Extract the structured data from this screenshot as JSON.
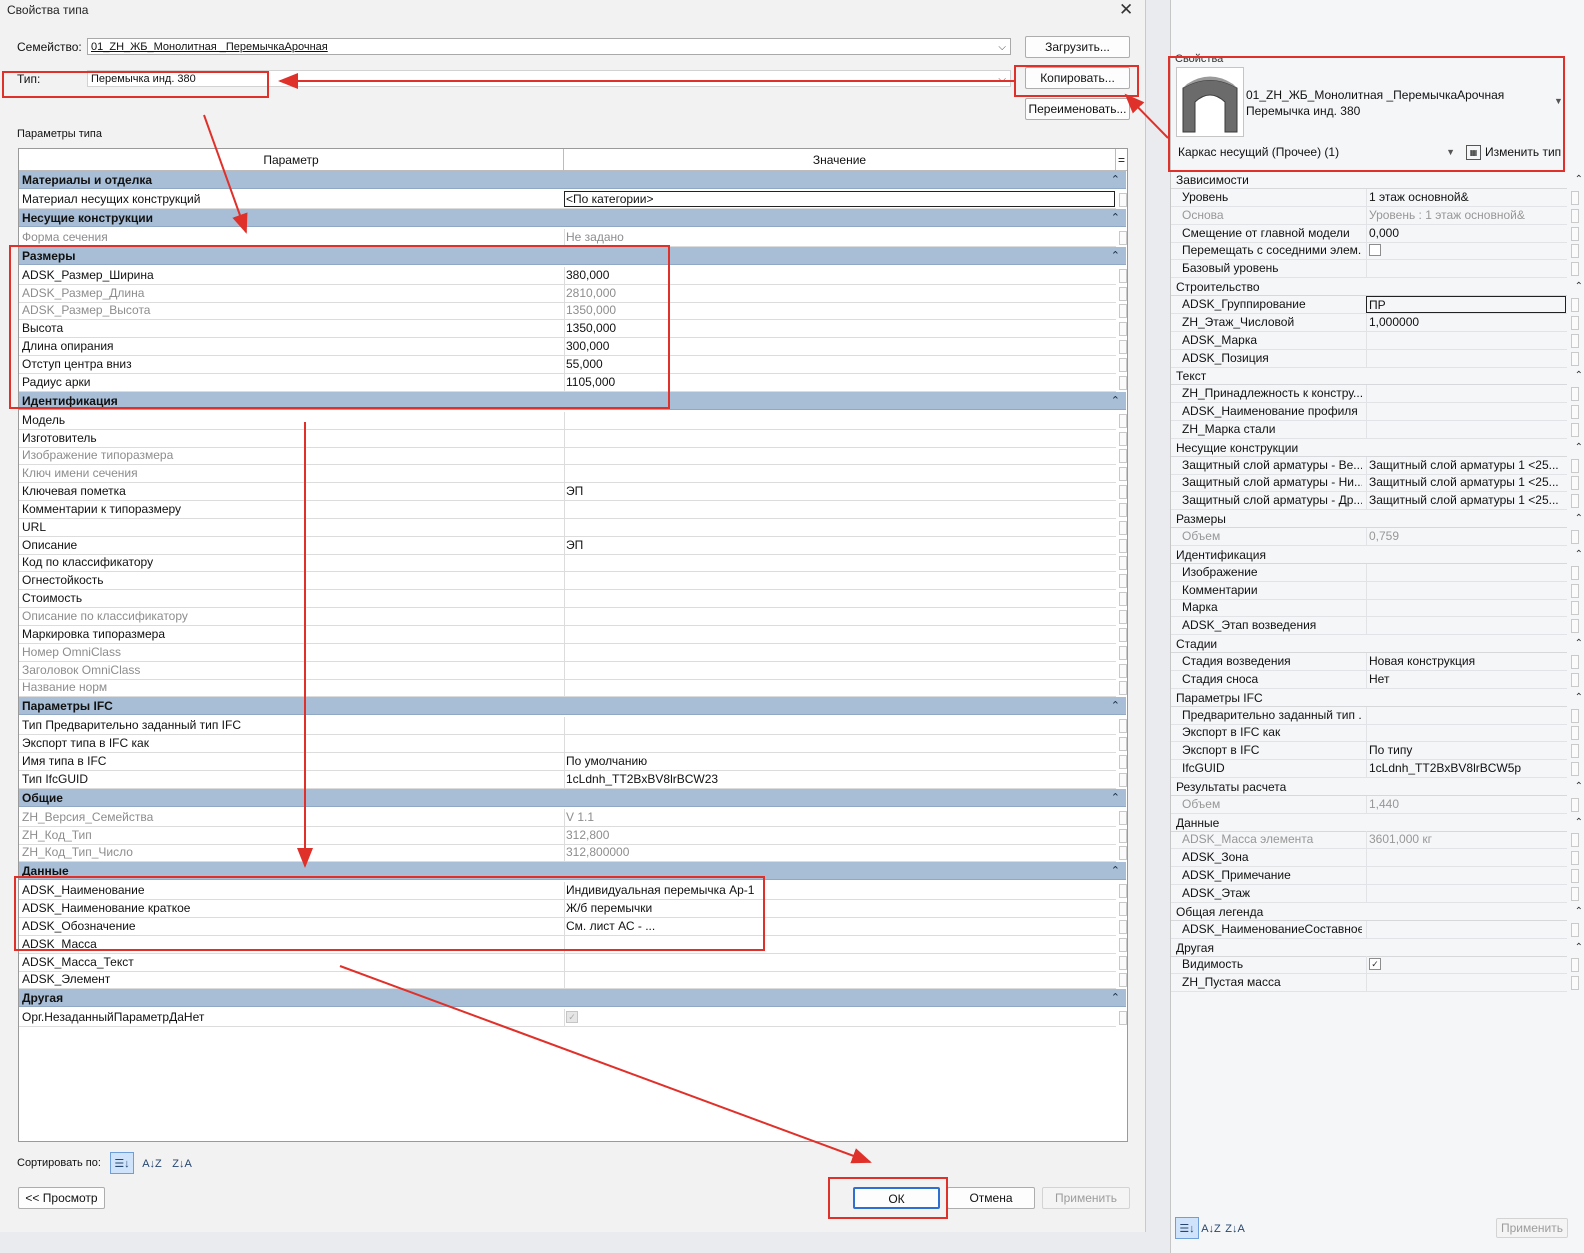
{
  "dialog": {
    "title": "Свойства типа",
    "close": "✕",
    "family_label": "Семейство:",
    "family_value": "01_ZH_ЖБ_Монолитная _ПеремычкаАрочная",
    "type_label": "Тип:",
    "type_value": "Перемычка инд. 380",
    "load_button": "Загрузить...",
    "copy_button": "Копировать...",
    "rename_button": "Переименовать...",
    "type_params_label": "Параметры типа",
    "col_param": "Параметр",
    "col_value": "Значение",
    "col_eq": "=",
    "sort_label": "Сортировать по:",
    "preview_button": "<< Просмотр",
    "ok_button": "ОК",
    "cancel_button": "Отмена",
    "apply_button": "Применить"
  },
  "grid_rows": [
    {
      "kind": "group",
      "name": "Материалы и отделка"
    },
    {
      "kind": "row",
      "name": "Материал несущих конструкций",
      "value": "<По категории>",
      "boxed": true
    },
    {
      "kind": "group",
      "name": "Несущие конструкции"
    },
    {
      "kind": "row",
      "name": "Форма сечения",
      "value": "Не задано",
      "disabled": true
    },
    {
      "kind": "group",
      "name": "Размеры"
    },
    {
      "kind": "row",
      "name": "ADSK_Размер_Ширина",
      "value": "380,000"
    },
    {
      "kind": "row",
      "name": "ADSK_Размер_Длина",
      "value": "2810,000",
      "disabled": true
    },
    {
      "kind": "row",
      "name": "ADSK_Размер_Высота",
      "value": "1350,000",
      "disabled": true
    },
    {
      "kind": "row",
      "name": "Высота",
      "value": "1350,000"
    },
    {
      "kind": "row",
      "name": "Длина опирания",
      "value": "300,000"
    },
    {
      "kind": "row",
      "name": "Отступ центра вниз",
      "value": "55,000"
    },
    {
      "kind": "row",
      "name": "Радиус арки",
      "value": "1105,000"
    },
    {
      "kind": "group",
      "name": "Идентификация"
    },
    {
      "kind": "row",
      "name": "Модель",
      "value": ""
    },
    {
      "kind": "row",
      "name": "Изготовитель",
      "value": ""
    },
    {
      "kind": "row",
      "name": "Изображение типоразмера",
      "value": "",
      "disabled": true
    },
    {
      "kind": "row",
      "name": "Ключ имени сечения",
      "value": "",
      "disabled": true
    },
    {
      "kind": "row",
      "name": "Ключевая пометка",
      "value": "ЭП"
    },
    {
      "kind": "row",
      "name": "Комментарии к типоразмеру",
      "value": ""
    },
    {
      "kind": "row",
      "name": "URL",
      "value": ""
    },
    {
      "kind": "row",
      "name": "Описание",
      "value": "ЭП"
    },
    {
      "kind": "row",
      "name": "Код по классификатору",
      "value": ""
    },
    {
      "kind": "row",
      "name": "Огнестойкость",
      "value": ""
    },
    {
      "kind": "row",
      "name": "Стоимость",
      "value": ""
    },
    {
      "kind": "row",
      "name": "Описание по классификатору",
      "value": "",
      "disabled": true
    },
    {
      "kind": "row",
      "name": "Маркировка типоразмера",
      "value": ""
    },
    {
      "kind": "row",
      "name": "Номер OmniClass",
      "value": "",
      "disabled": true
    },
    {
      "kind": "row",
      "name": "Заголовок OmniClass",
      "value": "",
      "disabled": true
    },
    {
      "kind": "row",
      "name": "Название норм",
      "value": "",
      "disabled": true
    },
    {
      "kind": "group",
      "name": "Параметры IFC"
    },
    {
      "kind": "row",
      "name": "Тип Предварительно заданный тип IFC",
      "value": ""
    },
    {
      "kind": "row",
      "name": "Экспорт типа в IFC как",
      "value": ""
    },
    {
      "kind": "row",
      "name": "Имя типа в IFC",
      "value": "По умолчанию"
    },
    {
      "kind": "row",
      "name": "Тип IfcGUID",
      "value": "1cLdnh_TT2BxBV8lrBCW23"
    },
    {
      "kind": "group",
      "name": "Общие"
    },
    {
      "kind": "row",
      "name": "ZH_Версия_Семейства",
      "value": "V 1.1",
      "disabled": true
    },
    {
      "kind": "row",
      "name": "ZH_Код_Тип",
      "value": "312,800",
      "disabled": true
    },
    {
      "kind": "row",
      "name": "ZH_Код_Тип_Число",
      "value": "312,800000",
      "disabled": true
    },
    {
      "kind": "group",
      "name": "Данные"
    },
    {
      "kind": "row",
      "name": "ADSK_Наименование",
      "value": "Индивидуальная перемычка Ар-1"
    },
    {
      "kind": "row",
      "name": "ADSK_Наименование краткое",
      "value": "Ж/б перемычки"
    },
    {
      "kind": "row",
      "name": "ADSK_Обозначение",
      "value": "См. лист АС - ..."
    },
    {
      "kind": "row",
      "name": "ADSK_Масса",
      "value": ""
    },
    {
      "kind": "row",
      "name": "ADSK_Масса_Текст",
      "value": ""
    },
    {
      "kind": "row",
      "name": "ADSK_Элемент",
      "value": ""
    },
    {
      "kind": "group",
      "name": "Другая"
    },
    {
      "kind": "row",
      "name": "Орг.НезаданныйПараметрДаНет",
      "value": "",
      "checkbox": "disabled"
    }
  ],
  "properties": {
    "header": "Свойства",
    "family_name": "01_ZH_ЖБ_Монолитная _ПеремычкаАрочная",
    "type_name": "Перемычка инд. 380",
    "filter_value": "Каркас несущий (Прочее) (1)",
    "edit_type_button": "Изменить тип",
    "apply_button": "Применить",
    "rows": [
      {
        "kind": "group",
        "name": "Зависимости"
      },
      {
        "kind": "row",
        "name": "Уровень",
        "value": "1 этаж основной&"
      },
      {
        "kind": "row",
        "name": "Основа",
        "value": "Уровень : 1 этаж основной&",
        "disabled": true
      },
      {
        "kind": "row",
        "name": "Смещение от главной модели",
        "value": "0,000"
      },
      {
        "kind": "row",
        "name": "Перемещать с соседними элем...",
        "value": "",
        "checkbox": "empty"
      },
      {
        "kind": "row",
        "name": "Базовый уровень",
        "value": ""
      },
      {
        "kind": "group",
        "name": "Строительство"
      },
      {
        "kind": "row",
        "name": "ADSK_Группирование",
        "value": "ПР",
        "boxed": true
      },
      {
        "kind": "row",
        "name": "ZH_Этаж_Числовой",
        "value": "1,000000"
      },
      {
        "kind": "row",
        "name": "ADSK_Марка",
        "value": ""
      },
      {
        "kind": "row",
        "name": "ADSK_Позиция",
        "value": ""
      },
      {
        "kind": "group",
        "name": "Текст"
      },
      {
        "kind": "row",
        "name": "ZH_Принадлежность к констру...",
        "value": ""
      },
      {
        "kind": "row",
        "name": "ADSK_Наименование профиля",
        "value": ""
      },
      {
        "kind": "row",
        "name": "ZH_Марка стали",
        "value": ""
      },
      {
        "kind": "group",
        "name": "Несущие конструкции"
      },
      {
        "kind": "row",
        "name": "Защитный слой арматуры - Ве...",
        "value": "Защитный слой арматуры 1 <25..."
      },
      {
        "kind": "row",
        "name": "Защитный слой арматуры - Ни...",
        "value": "Защитный слой арматуры 1 <25..."
      },
      {
        "kind": "row",
        "name": "Защитный слой арматуры - Др...",
        "value": "Защитный слой арматуры 1 <25..."
      },
      {
        "kind": "group",
        "name": "Размеры"
      },
      {
        "kind": "row",
        "name": "Объем",
        "value": "0,759",
        "disabled": true
      },
      {
        "kind": "group",
        "name": "Идентификация"
      },
      {
        "kind": "row",
        "name": "Изображение",
        "value": ""
      },
      {
        "kind": "row",
        "name": "Комментарии",
        "value": ""
      },
      {
        "kind": "row",
        "name": "Марка",
        "value": ""
      },
      {
        "kind": "row",
        "name": "ADSK_Этап возведения",
        "value": ""
      },
      {
        "kind": "group",
        "name": "Стадии"
      },
      {
        "kind": "row",
        "name": "Стадия возведения",
        "value": "Новая конструкция"
      },
      {
        "kind": "row",
        "name": "Стадия сноса",
        "value": "Нет"
      },
      {
        "kind": "group",
        "name": "Параметры IFC"
      },
      {
        "kind": "row",
        "name": "Предварительно заданный тип ...",
        "value": ""
      },
      {
        "kind": "row",
        "name": "Экспорт в IFC как",
        "value": ""
      },
      {
        "kind": "row",
        "name": "Экспорт в IFC",
        "value": "По типу"
      },
      {
        "kind": "row",
        "name": "IfcGUID",
        "value": "1cLdnh_TT2BxBV8lrBCW5p"
      },
      {
        "kind": "group",
        "name": "Результаты расчета"
      },
      {
        "kind": "row",
        "name": "Объем",
        "value": "1,440",
        "disabled": true
      },
      {
        "kind": "group",
        "name": "Данные"
      },
      {
        "kind": "row",
        "name": "ADSK_Масса элемента",
        "value": "3601,000 кг",
        "disabled": true
      },
      {
        "kind": "row",
        "name": "ADSK_Зона",
        "value": ""
      },
      {
        "kind": "row",
        "name": "ADSK_Примечание",
        "value": ""
      },
      {
        "kind": "row",
        "name": "ADSK_Этаж",
        "value": ""
      },
      {
        "kind": "group",
        "name": "Общая легенда"
      },
      {
        "kind": "row",
        "name": "ADSK_НаименованиеСоставное...",
        "value": ""
      },
      {
        "kind": "group",
        "name": "Другая"
      },
      {
        "kind": "row",
        "name": "Видимость",
        "value": "",
        "checkbox": "checked"
      },
      {
        "kind": "row",
        "name": "ZH_Пустая масса",
        "value": ""
      }
    ]
  },
  "annotation_color": "#e0302a",
  "header_color": "#a7bed6"
}
